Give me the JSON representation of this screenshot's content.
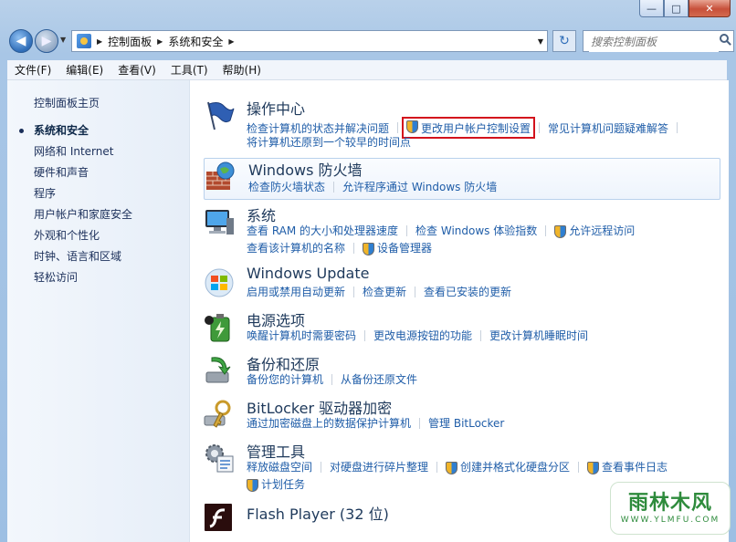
{
  "window": {
    "buttons": {
      "minimize": "—",
      "maximize": "□",
      "close": "✕"
    }
  },
  "nav": {
    "back_icon": "◀",
    "forward_icon": "▶",
    "breadcrumb": [
      "控制面板",
      "系统和安全"
    ],
    "refresh_icon": "↻",
    "search_placeholder": "搜索控制面板"
  },
  "menubar": [
    "文件(F)",
    "编辑(E)",
    "查看(V)",
    "工具(T)",
    "帮助(H)"
  ],
  "sidebar": {
    "home": "控制面板主页",
    "items": [
      "系统和安全",
      "网络和 Internet",
      "硬件和声音",
      "程序",
      "用户帐户和家庭安全",
      "外观和个性化",
      "时钟、语言和区域",
      "轻松访问"
    ]
  },
  "categories": {
    "action_center": {
      "title": "操作中心",
      "links": [
        "检查计算机的状态并解决问题",
        "更改用户帐户控制设置",
        "常见计算机问题疑难解答",
        "将计算机还原到一个较早的时间点"
      ]
    },
    "firewall": {
      "title": "Windows 防火墙",
      "links": [
        "检查防火墙状态",
        "允许程序通过 Windows 防火墙"
      ]
    },
    "system": {
      "title": "系统",
      "links": [
        "查看 RAM 的大小和处理器速度",
        "检查 Windows 体验指数",
        "允许远程访问",
        "查看该计算机的名称",
        "设备管理器"
      ]
    },
    "windows_update": {
      "title": "Windows Update",
      "links": [
        "启用或禁用自动更新",
        "检查更新",
        "查看已安装的更新"
      ]
    },
    "power": {
      "title": "电源选项",
      "links": [
        "唤醒计算机时需要密码",
        "更改电源按钮的功能",
        "更改计算机睡眠时间"
      ]
    },
    "backup": {
      "title": "备份和还原",
      "links": [
        "备份您的计算机",
        "从备份还原文件"
      ]
    },
    "bitlocker": {
      "title": "BitLocker 驱动器加密",
      "links": [
        "通过加密磁盘上的数据保护计算机",
        "管理 BitLocker"
      ]
    },
    "admin_tools": {
      "title": "管理工具",
      "links": [
        "释放磁盘空间",
        "对硬盘进行碎片整理",
        "创建并格式化硬盘分区",
        "查看事件日志",
        "计划任务"
      ]
    },
    "flash": {
      "title": "Flash Player (32 位)"
    }
  },
  "watermark": {
    "title": "雨林木风",
    "url": "WWW.YLMFU.COM"
  },
  "colors": {
    "link": "#1f5da8",
    "title": "#1e395b",
    "highlight_border": "#d3121c"
  }
}
